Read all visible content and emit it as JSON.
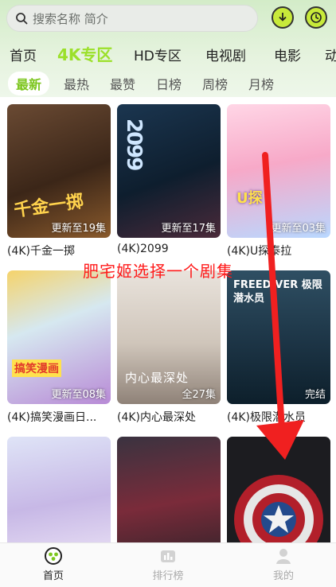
{
  "search": {
    "placeholder": "搜索名称 简介",
    "icon": "search-icon"
  },
  "top_actions": [
    {
      "name": "download",
      "icon": "download-icon"
    },
    {
      "name": "history",
      "icon": "history-icon"
    }
  ],
  "tabs": [
    "首页",
    "4K专区",
    "HD专区",
    "电视剧",
    "电影",
    "动"
  ],
  "active_tab": "4K专区",
  "subtabs": [
    "最新",
    "最热",
    "最赞",
    "日榜",
    "周榜",
    "月榜"
  ],
  "active_subtab": "最新",
  "cards": [
    {
      "title": "(4K)千金一掷",
      "badge": "更新至19集",
      "poster_text": "千金一掷"
    },
    {
      "title": "(4K)2099",
      "badge": "更新至17集",
      "poster_text": "2099"
    },
    {
      "title": "(4K)U探泰拉",
      "badge": "更新至03集",
      "poster_text": "U探"
    },
    {
      "title": "(4K)搞笑漫画日...",
      "badge": "更新至08集",
      "poster_text": "搞笑漫画"
    },
    {
      "title": "(4K)内心最深处",
      "badge": "全27集",
      "poster_text": "内心最深处"
    },
    {
      "title": "(4K)极限潜水员",
      "badge": "完结",
      "poster_text": "FREEDIVER 极限潜水员"
    },
    {
      "title": "",
      "badge": "",
      "poster_text": ""
    },
    {
      "title": "",
      "badge": "",
      "poster_text": ""
    },
    {
      "title": "",
      "badge": "",
      "poster_text": ""
    }
  ],
  "annotation": "肥宅姬选择一个剧集",
  "bottom_nav": [
    {
      "label": "首页",
      "icon": "home-icon",
      "active": true
    },
    {
      "label": "排行榜",
      "icon": "ranking-icon",
      "active": false
    },
    {
      "label": "我的",
      "icon": "profile-icon",
      "active": false
    }
  ],
  "colors": {
    "accent": "#9be02a",
    "annotation": "#ff1a1a",
    "header_bg": "#d3ecc8"
  }
}
